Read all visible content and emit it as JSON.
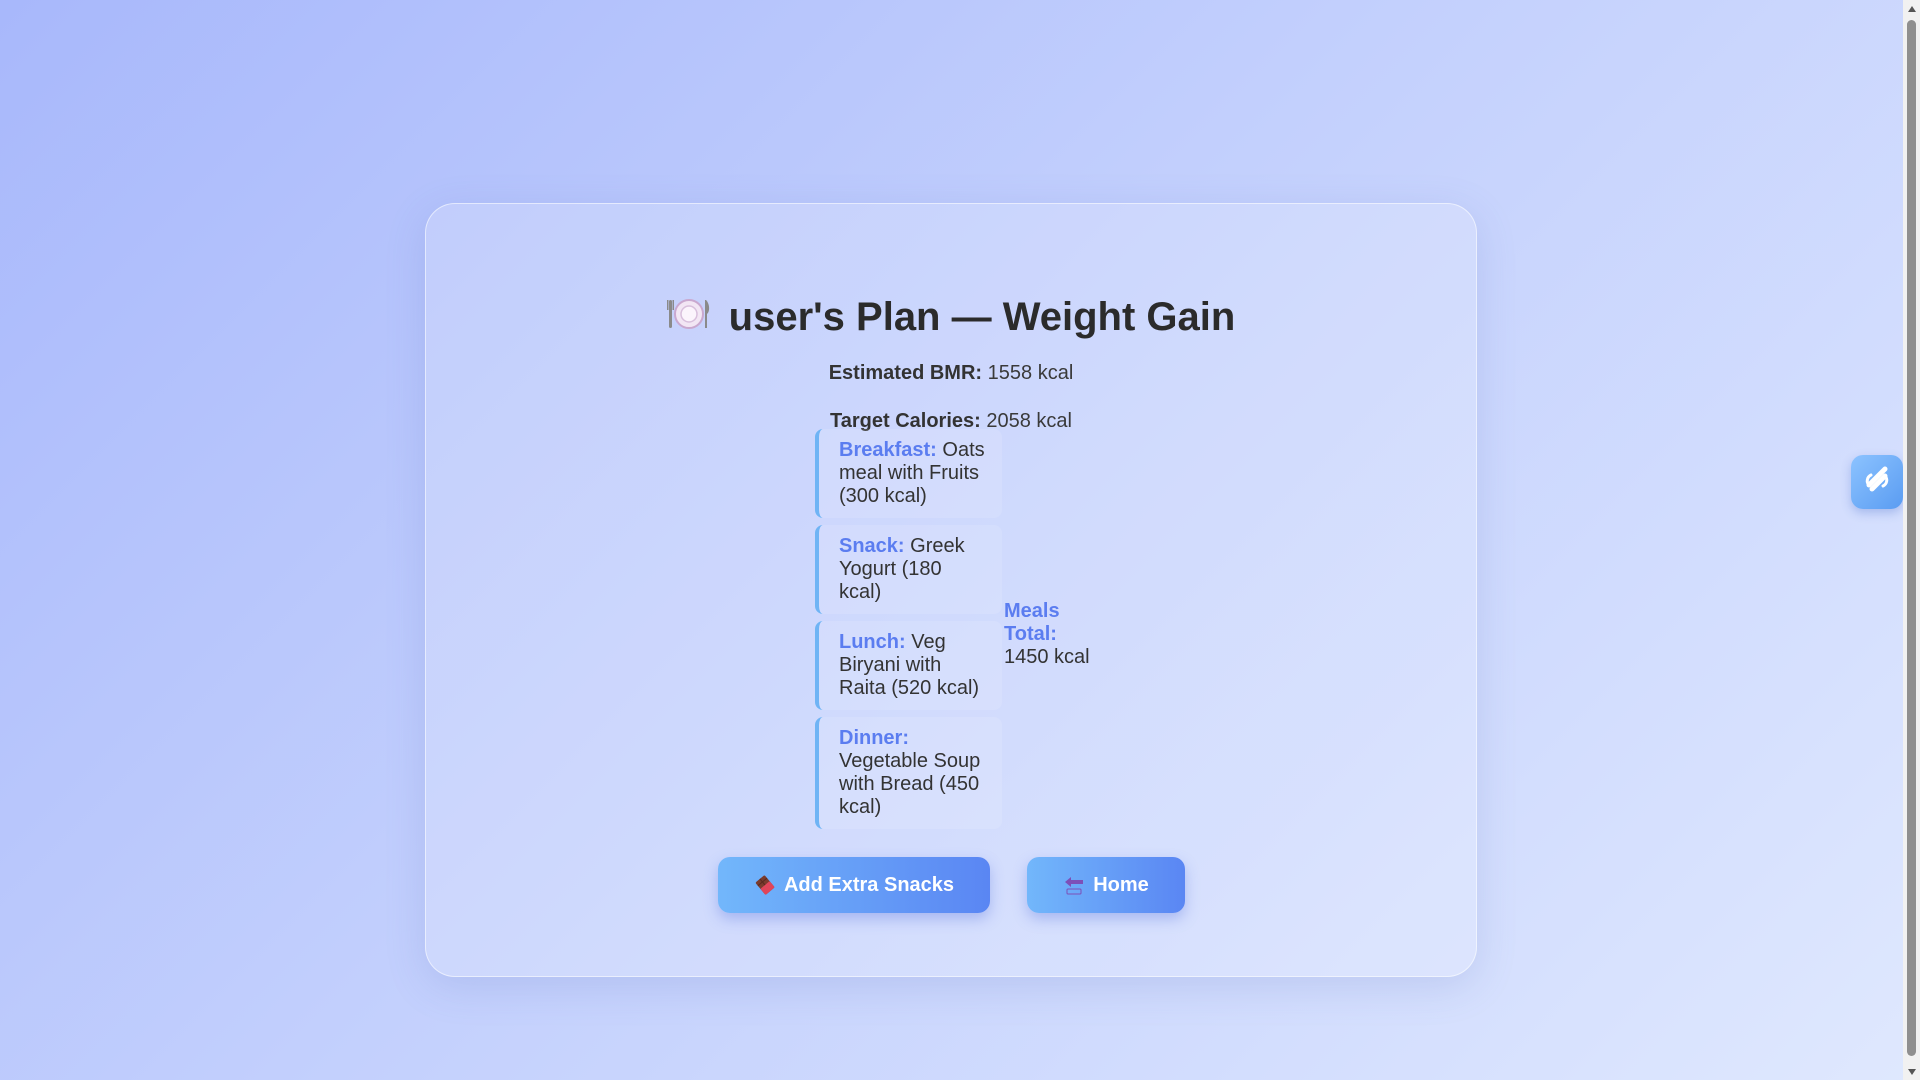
{
  "plan": {
    "title": "user's Plan — Weight Gain",
    "title_icon": "plate-cutlery-icon",
    "bmr_label": "Estimated BMR:",
    "bmr_value": "1558 kcal",
    "target_label": "Target Calories:",
    "target_value": "2058 kcal"
  },
  "meals": [
    {
      "name": "Breakfast:",
      "desc": "Oats meal with Fruits (300 kcal)"
    },
    {
      "name": "Snack:",
      "desc": "Greek Yogurt (180 kcal)"
    },
    {
      "name": "Lunch:",
      "desc": "Veg Biryani with Raita (520 kcal)"
    },
    {
      "name": "Dinner:",
      "desc": "Vegetable Soup with Bread (450 kcal)"
    }
  ],
  "total": {
    "label": "Meals Total:",
    "value": "1450 kcal"
  },
  "buttons": {
    "add_snacks_label": "Add Extra Snacks",
    "add_snacks_icon": "chocolate-bar-icon",
    "home_label": "Home",
    "home_icon": "back-arrow-icon"
  },
  "side_widget": {
    "icon": "swirl-logo-icon"
  },
  "colors": {
    "accent": "#5b7df0",
    "meal_border": "#6fb4f5",
    "button_start": "#72b7fb",
    "button_end": "#5a86f3"
  }
}
